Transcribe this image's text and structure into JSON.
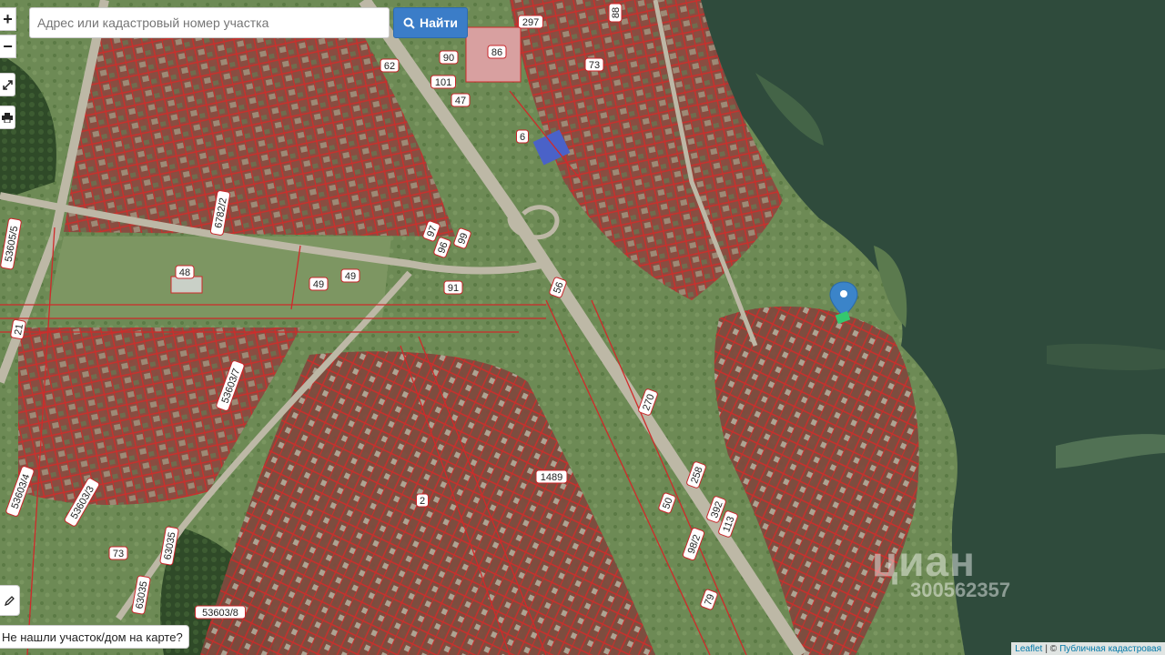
{
  "search": {
    "placeholder": "Адрес или кадастровый номер участка",
    "button_label": "Найти"
  },
  "controls": {
    "zoom_in": "+",
    "zoom_out": "−"
  },
  "not_found_label": "Не нашли участок/дом на карте?",
  "attribution": {
    "leaflet": "Leaflet",
    "separator": "| ©",
    "source": "Публичная кадастровая"
  },
  "watermark": {
    "brand": "циан",
    "number": "300562357"
  },
  "parcel_labels": [
    "297",
    "86",
    "90",
    "62",
    "101",
    "47",
    "73",
    "88",
    "6",
    "6782/2",
    "53605/5",
    "21",
    "97",
    "96",
    "99",
    "48",
    "49",
    "49",
    "91",
    "56",
    "53603/7",
    "53603/4",
    "53603/3",
    "270",
    "1489",
    "2",
    "258",
    "50",
    "392",
    "113",
    "98/2",
    "73",
    "63035",
    "63035",
    "53603/8",
    "79"
  ],
  "colors": {
    "parcel_border": "#c8262a",
    "water": "#2e4a3a",
    "land": "#6e8a56",
    "road": "#c9c4b2",
    "marker": "#3b84c9",
    "selected_parcel": "#34c76e"
  }
}
